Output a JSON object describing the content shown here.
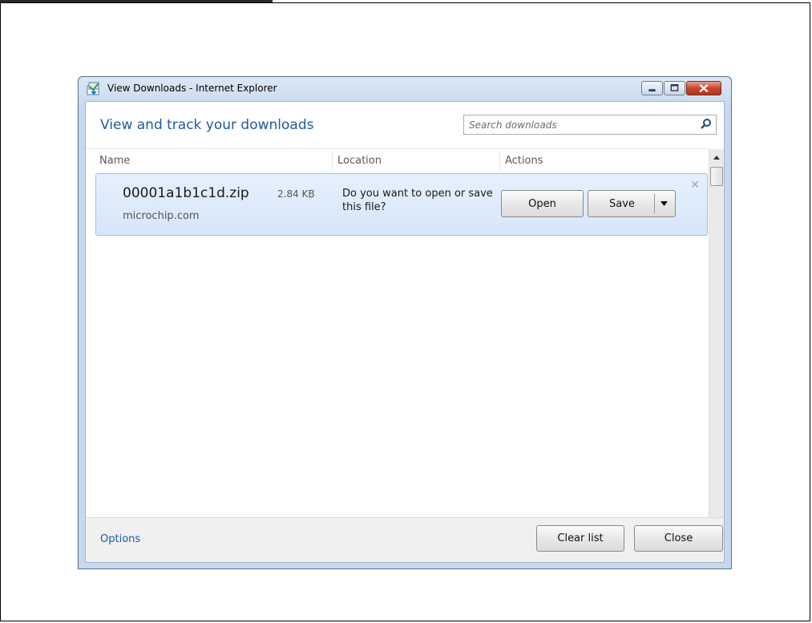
{
  "window": {
    "title": "View Downloads - Internet Explorer"
  },
  "header": {
    "title": "View and track your downloads",
    "search_placeholder": "Search downloads"
  },
  "columns": {
    "name": "Name",
    "location": "Location",
    "actions": "Actions"
  },
  "downloads": [
    {
      "file_name": "00001a1b1c1d.zip",
      "size": "2.84 KB",
      "source": "microchip.com",
      "prompt": "Do you want to open or save this file?",
      "open_label": "Open",
      "save_label": "Save"
    }
  ],
  "footer": {
    "options_label": "Options",
    "clear_list_label": "Clear list",
    "close_label": "Close"
  },
  "colors": {
    "accent_blue": "#1e5aa0",
    "row_highlight": "#d6e6fa",
    "close_button_red": "#c9452d"
  }
}
